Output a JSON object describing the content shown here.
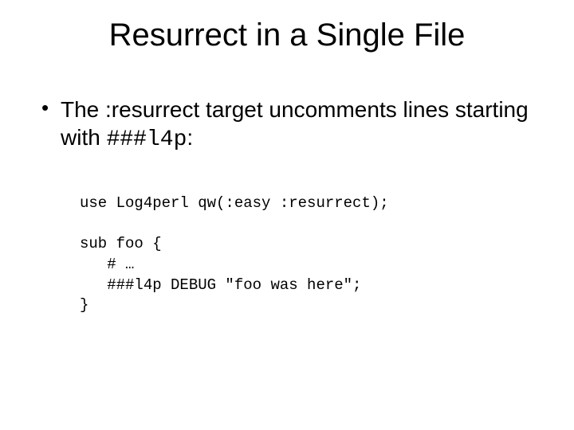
{
  "title": "Resurrect in a Single File",
  "bullet": {
    "prefix": "The :resurrect target uncomments lines starting with ",
    "code": "###l4p",
    "suffix": ":"
  },
  "code": {
    "line1": "use Log4perl qw(:easy :resurrect);",
    "line2": "",
    "line3": "sub foo {",
    "line4": "   # …",
    "line5": "   ###l4p DEBUG \"foo was here\";",
    "line6": "}"
  }
}
